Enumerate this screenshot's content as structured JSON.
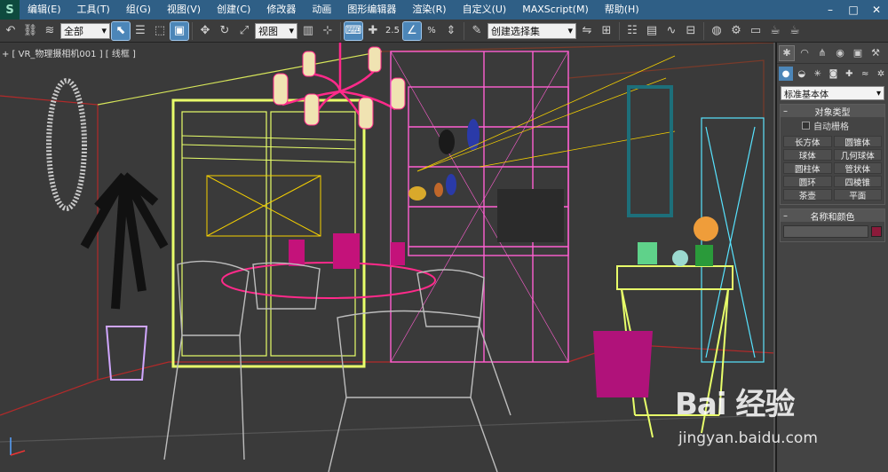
{
  "menubar": {
    "logo": "S",
    "items": [
      "编辑(E)",
      "工具(T)",
      "组(G)",
      "视图(V)",
      "创建(C)",
      "修改器",
      "动画",
      "图形编辑器",
      "渲染(R)",
      "自定义(U)",
      "MAXScript(M)",
      "帮助(H)"
    ]
  },
  "window_controls": [
    "–",
    "□",
    "✕"
  ],
  "toolbar": {
    "selection_filter": "全部",
    "reference_coord": "视图",
    "snap_angle_label": "2.5",
    "percent_label": "%",
    "named_selection": "创建选择集"
  },
  "viewport": {
    "label": "+ [ VR_物理摄相机001 ] [ 线框 ]",
    "wireframe_colors": [
      "#ff5fd1",
      "#e8ff6a",
      "#6fff6f",
      "#57e3ff",
      "#c3c3c3",
      "#ff2a8a",
      "#f5d000"
    ]
  },
  "command_panel": {
    "tabs": [
      "create-icon",
      "modify-icon",
      "hierarchy-icon",
      "motion-icon",
      "display-icon",
      "utilities-icon"
    ],
    "category_dropdown": "标准基本体",
    "object_type": {
      "title": "对象类型",
      "autogrid_label": "自动栅格",
      "buttons": [
        "长方体",
        "圆锥体",
        "球体",
        "几何球体",
        "圆柱体",
        "管状体",
        "圆环",
        "四棱锥",
        "茶壶",
        "平面"
      ]
    },
    "name_color": {
      "title": "名称和颜色",
      "swatch": "#8b1a3a"
    }
  },
  "watermark": {
    "brand": "Bai 经验",
    "url": "jingyan.baidu.com"
  }
}
